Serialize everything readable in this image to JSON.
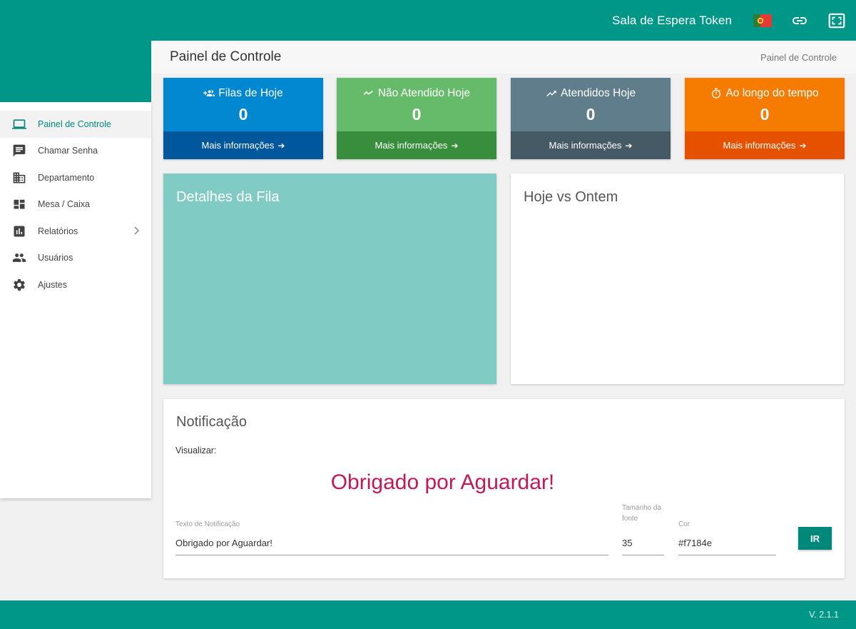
{
  "header": {
    "app_title": "Sala de Espera Token",
    "icons": [
      "portugal-flag-icon",
      "link-icon",
      "fullscreen-icon"
    ]
  },
  "sidebar": {
    "items": [
      {
        "label": "Painel de Controle",
        "icon": "laptop-icon",
        "active": true
      },
      {
        "label": "Chamar Senha",
        "icon": "message-icon"
      },
      {
        "label": "Departamento",
        "icon": "building-icon"
      },
      {
        "label": "Mesa / Caixa",
        "icon": "dashboard-icon"
      },
      {
        "label": "Relatórios",
        "icon": "bar-chart-icon",
        "has_submenu": true
      },
      {
        "label": "Usuários",
        "icon": "people-icon"
      },
      {
        "label": "Ajustes",
        "icon": "gear-icon"
      }
    ]
  },
  "page": {
    "title": "Painel de Controle",
    "breadcrumb": "Painel de Controle"
  },
  "stats": [
    {
      "title": "Filas de Hoje",
      "value": "0",
      "link": "Mais informações",
      "icon": "group-add-icon",
      "color": "#0288d1",
      "footer_color": "#01579b"
    },
    {
      "title": "Não Atendido Hoje",
      "value": "0",
      "link": "Mais informações",
      "icon": "trending-flat-icon",
      "color": "#66bb6a",
      "footer_color": "#388e3c"
    },
    {
      "title": "Atendidos Hoje",
      "value": "0",
      "link": "Mais informações",
      "icon": "trending-up-icon",
      "color": "#607d8b",
      "footer_color": "#455a64"
    },
    {
      "title": "Ao longo do tempo",
      "value": "0",
      "link": "Mais informações",
      "icon": "timer-icon",
      "color": "#f57c00",
      "footer_color": "#e65100"
    }
  ],
  "queue_details": {
    "title": "Detalhes da Fila",
    "color": "#80cbc4"
  },
  "comparison": {
    "title": "Hoje vs Ontem"
  },
  "notification": {
    "title": "Notificação",
    "preview_label": "Visualizar:",
    "preview_text": "Obrigado por Aguardar!",
    "text_label": "Texto de Notificação",
    "text_value": "Obrigado por Aguardar!",
    "font_size_label": "Tamanho da fonte",
    "font_size_value": "35",
    "color_label": "Cor",
    "color_value": "#f7184e",
    "preview_color": "#c2185b",
    "button_label": "IR"
  },
  "footer": {
    "version": "V. 2.1.1"
  },
  "colors": {
    "primary": "#009688",
    "accent": "#00897b"
  }
}
